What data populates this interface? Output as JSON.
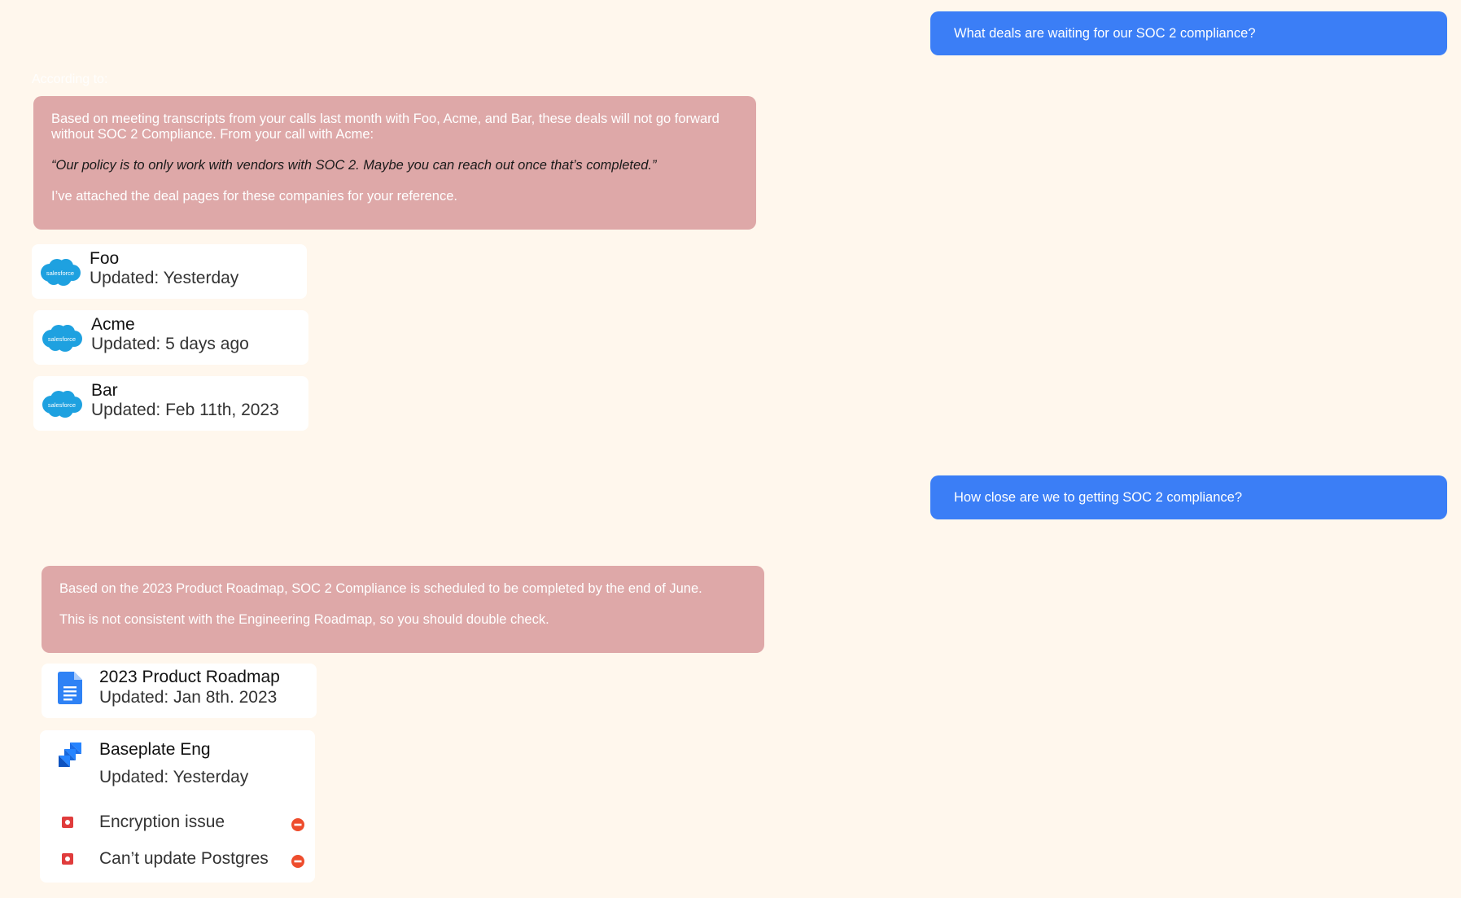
{
  "colors": {
    "background": "#fff7ed",
    "user_bubble": "#3b7ef6",
    "bot_bubble": "#dea8a8",
    "salesforce": "#1ea1e0",
    "issue_red": "#e03c3c",
    "minus_badge": "#ee4d2d"
  },
  "conversation": {
    "q1": {
      "text": "What deals are waiting for our SOC 2 compliance?"
    },
    "according_to": "According to:",
    "a1": {
      "paragraph1": "Based on meeting transcripts from your calls last month with Foo, Acme, and Bar, these deals will not go forward without SOC 2 Compliance. From your call with Acme:",
      "quote": "“Our policy is to only work with vendors with SOC 2. Maybe you can reach out once that’s completed.”",
      "paragraph2": "I’ve attached the deal pages for these companies for your reference."
    },
    "deals": [
      {
        "name": "Foo",
        "updated": "Updated: Yesterday",
        "icon": "salesforce-icon",
        "logo_text": "salesforce"
      },
      {
        "name": "Acme",
        "updated": "Updated: 5 days ago",
        "icon": "salesforce-icon",
        "logo_text": "salesforce"
      },
      {
        "name": "Bar",
        "updated": "Updated: Feb 11th, 2023",
        "icon": "salesforce-icon",
        "logo_text": "salesforce"
      }
    ],
    "q2": {
      "text": "How close are we to getting SOC 2 compliance?"
    },
    "a2": {
      "paragraph1": "Based on the 2023 Product Roadmap, SOC 2 Compliance is scheduled to be completed by the end of June.",
      "paragraph2": "This is not consistent with the Engineering Roadmap, so you should double check."
    },
    "roadmap_doc": {
      "title": "2023 Product Roadmap",
      "updated": "Updated: Jan 8th. 2023",
      "icon": "google-docs-icon"
    },
    "jira_board": {
      "title": "Baseplate Eng",
      "updated": "Updated: Yesterday",
      "icon": "jira-icon",
      "issues": [
        {
          "label": "Encryption issue",
          "type_icon": "bug-icon",
          "priority_icon": "blocker-icon"
        },
        {
          "label": "Can’t update Postgres",
          "type_icon": "bug-icon",
          "priority_icon": "blocker-icon"
        }
      ]
    }
  }
}
